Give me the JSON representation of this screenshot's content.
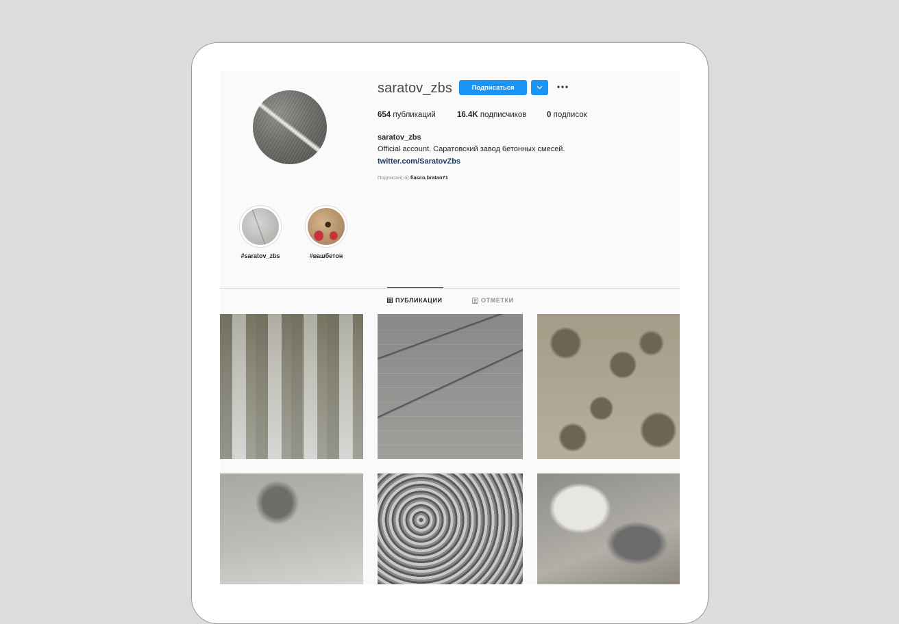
{
  "profile": {
    "username": "saratov_zbs",
    "follow_label": "Подписаться",
    "dropdown_icon": "chevron-down-icon",
    "more_icon": "more-options-icon",
    "stats": {
      "posts_count": "654",
      "posts_label": "публикаций",
      "followers_count": "16.4K",
      "followers_label": "подписчиков",
      "following_count": "0",
      "following_label": "подписок"
    },
    "bio": {
      "name": "saratov_zbs",
      "text": "Official account. Саратовский завод бетонных смесей.",
      "link": "twitter.com/SaratovZbs"
    },
    "followed_by": {
      "prefix": "Подписан(-а)",
      "user": "fiasco.bratan71"
    }
  },
  "highlights": [
    {
      "label": "#saratov_zbs"
    },
    {
      "label": "#вашбетон"
    }
  ],
  "tabs": [
    {
      "label": "ПУБЛИКАЦИИ",
      "icon": "grid-icon",
      "active": true
    },
    {
      "label": "ОТМЕТКИ",
      "icon": "tagged-icon",
      "active": false
    }
  ],
  "colors": {
    "accent": "#1a95f5",
    "link": "#1f3b63",
    "background": "#dcdcdc"
  }
}
